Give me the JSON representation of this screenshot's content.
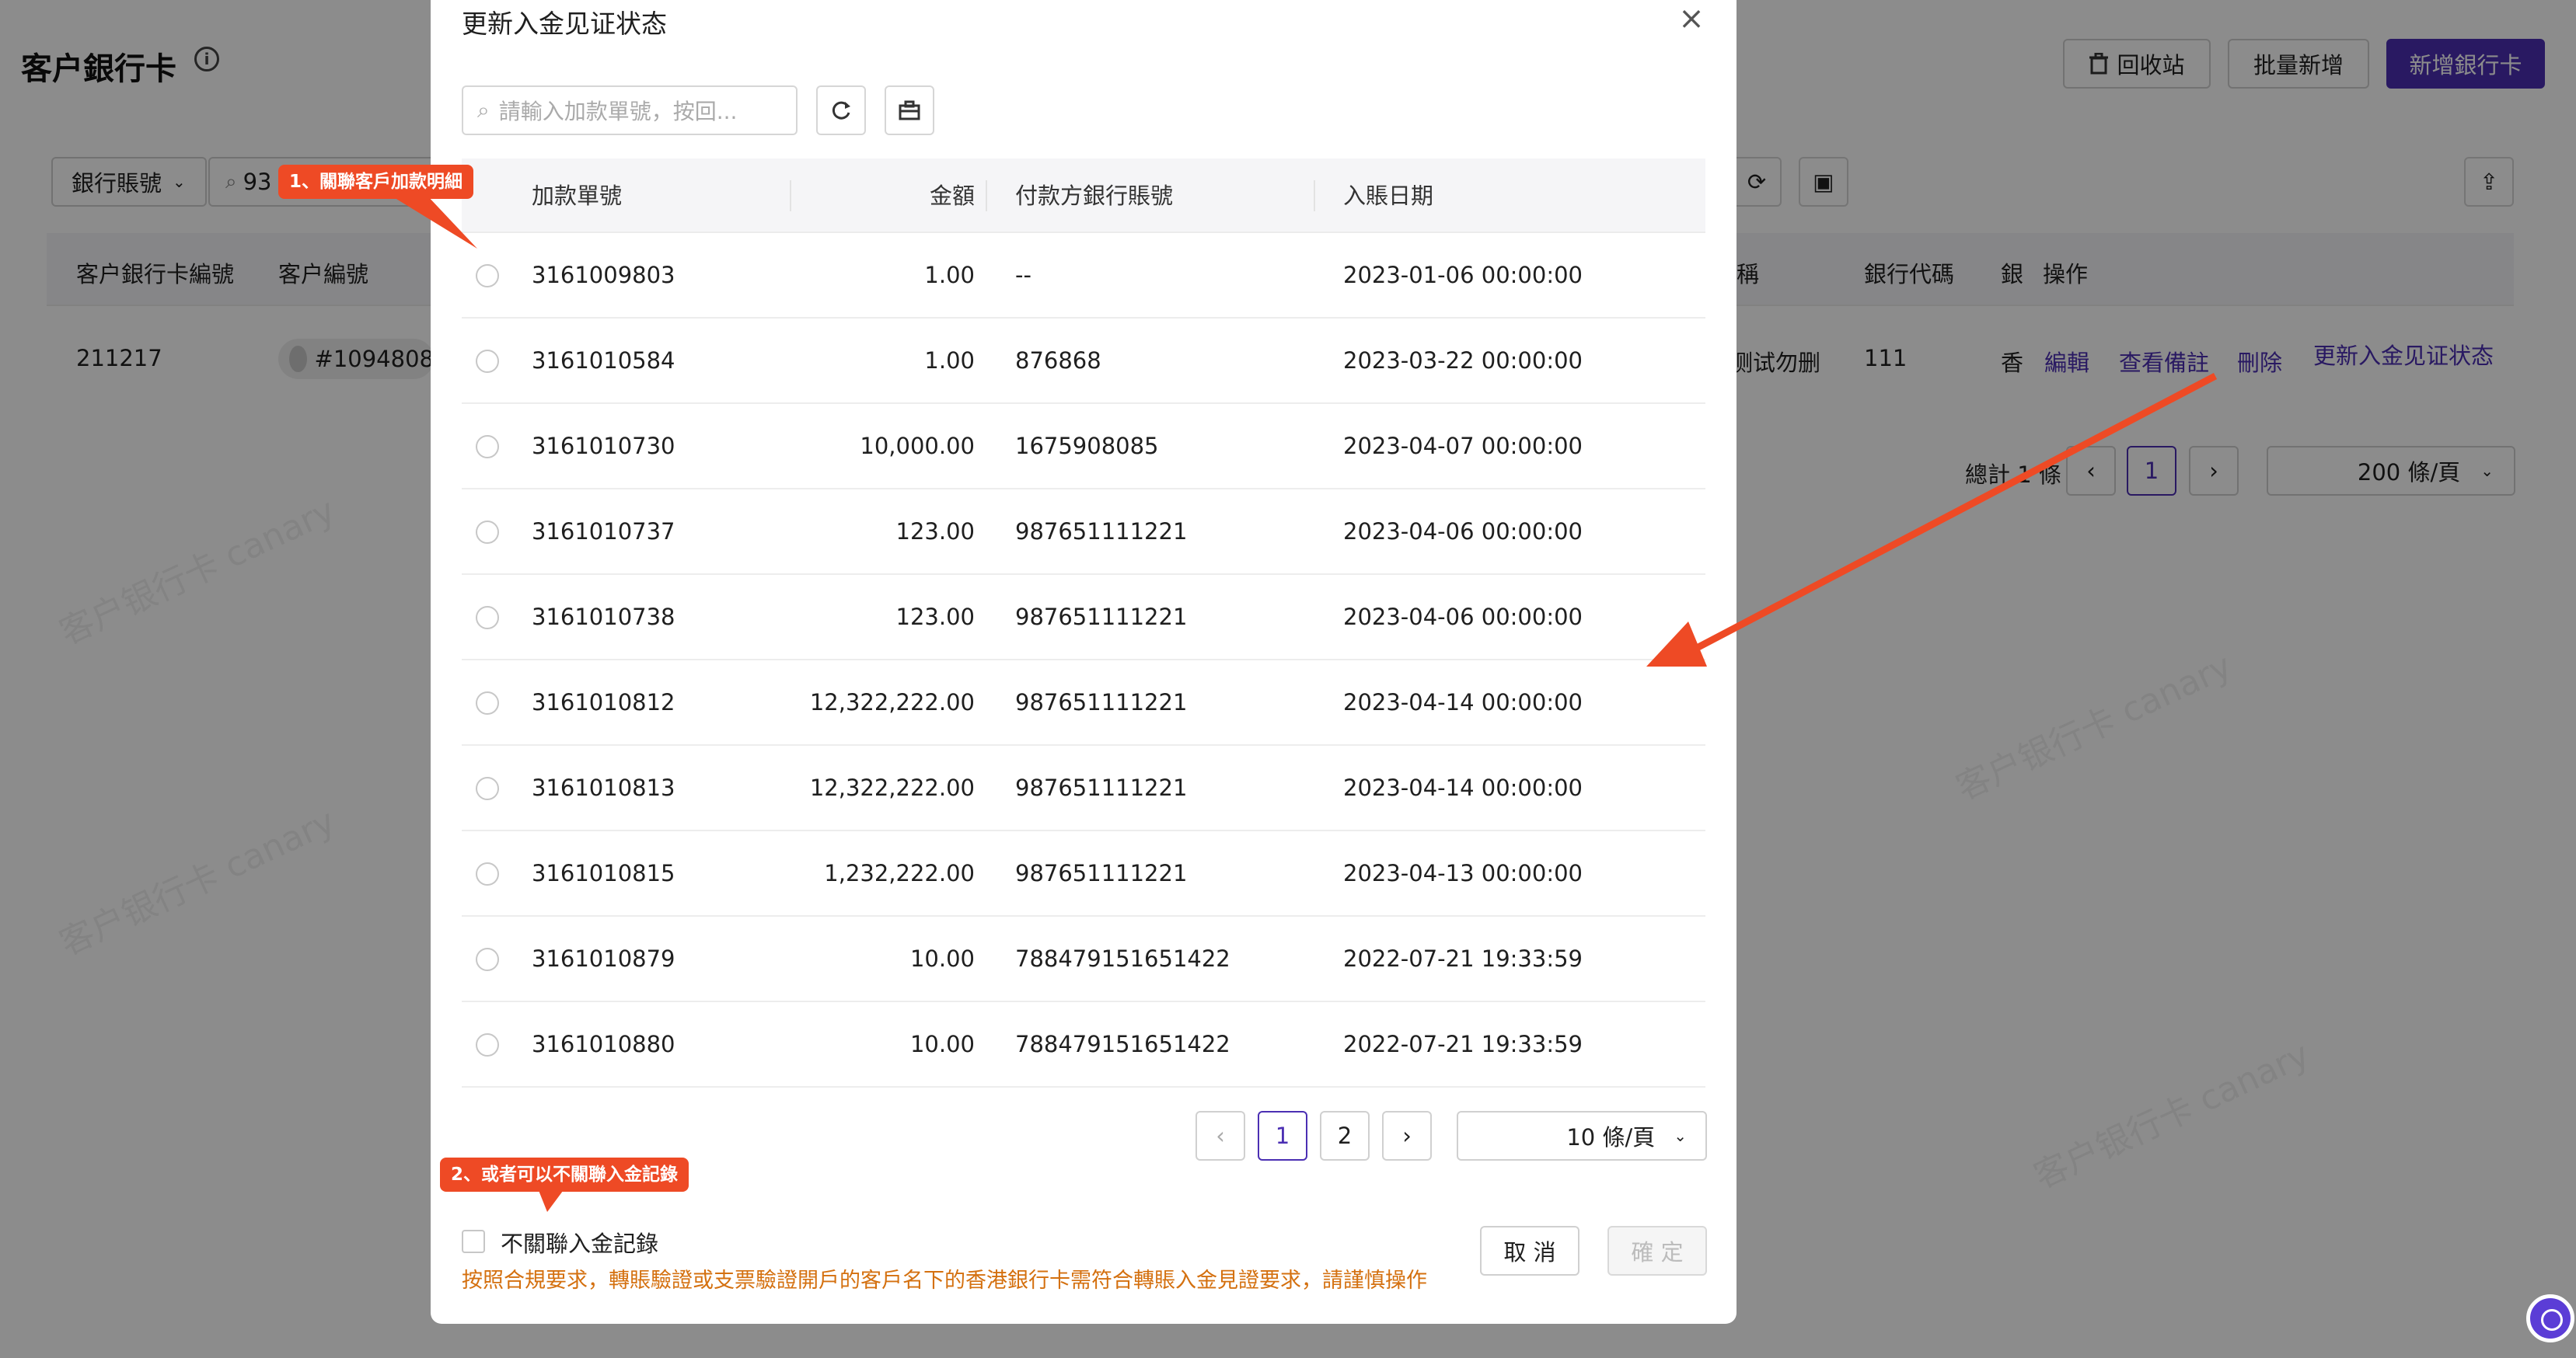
{
  "page": {
    "title": "客户銀行卡",
    "recycle_label": "回收站",
    "batch_add_label": "批量新增",
    "add_card_label": "新增銀行卡",
    "filter_select": "銀行賬號",
    "search_value": "93",
    "table_headers": [
      "客户銀行卡編號",
      "客户編號",
      "稱",
      "銀行代碼",
      "銀",
      "操作"
    ],
    "row": {
      "card_id": "211217",
      "customer_id": "#1094808",
      "name": "测试勿删",
      "bank_code": "111",
      "region": "香"
    },
    "actions": [
      "編輯",
      "查看備註",
      "刪除",
      "更新入金见证状态"
    ],
    "pagination": {
      "total": "總計 1 條",
      "current_page": "1",
      "page_size": "200 條/頁"
    }
  },
  "modal": {
    "title": "更新入金见证状态",
    "search_placeholder": "請輸入加款單號，按回...",
    "columns": [
      "加款單號",
      "金額",
      "付款方銀行賬號",
      "入賬日期"
    ],
    "rows": [
      {
        "id": "3161009803",
        "amount": "1.00",
        "account": "--",
        "date": "2023-01-06 00:00:00"
      },
      {
        "id": "3161010584",
        "amount": "1.00",
        "account": "876868",
        "date": "2023-03-22 00:00:00"
      },
      {
        "id": "3161010730",
        "amount": "10,000.00",
        "account": "1675908085",
        "date": "2023-04-07 00:00:00"
      },
      {
        "id": "3161010737",
        "amount": "123.00",
        "account": "987651111221",
        "date": "2023-04-06 00:00:00"
      },
      {
        "id": "3161010738",
        "amount": "123.00",
        "account": "987651111221",
        "date": "2023-04-06 00:00:00"
      },
      {
        "id": "3161010812",
        "amount": "12,322,222.00",
        "account": "987651111221",
        "date": "2023-04-14 00:00:00"
      },
      {
        "id": "3161010813",
        "amount": "12,322,222.00",
        "account": "987651111221",
        "date": "2023-04-14 00:00:00"
      },
      {
        "id": "3161010815",
        "amount": "1,232,222.00",
        "account": "987651111221",
        "date": "2023-04-13 00:00:00"
      },
      {
        "id": "3161010879",
        "amount": "10.00",
        "account": "788479151651422",
        "date": "2022-07-21 19:33:59"
      },
      {
        "id": "3161010880",
        "amount": "10.00",
        "account": "788479151651422",
        "date": "2022-07-21 19:33:59"
      }
    ],
    "pagination": {
      "pages": [
        "1",
        "2"
      ],
      "current_page": "1",
      "page_size": "10 條/頁"
    },
    "no_link_label": "不關聯入金記錄",
    "warning_text": "按照合規要求，轉賬驗證或支票驗證開戶的客戶名下的香港銀行卡需符合轉賬入金見證要求，請謹慎操作",
    "cancel_label": "取 消",
    "confirm_label": "確 定"
  },
  "annotations": {
    "step1": "1、關聯客戶加款明細",
    "step2": "2、或者可以不關聯入金記錄"
  },
  "watermark_text": "客户银行卡 canary",
  "colors": {
    "accent": "#4b2fb3",
    "annotation": "#ee4a25",
    "warning": "#d4700f"
  }
}
